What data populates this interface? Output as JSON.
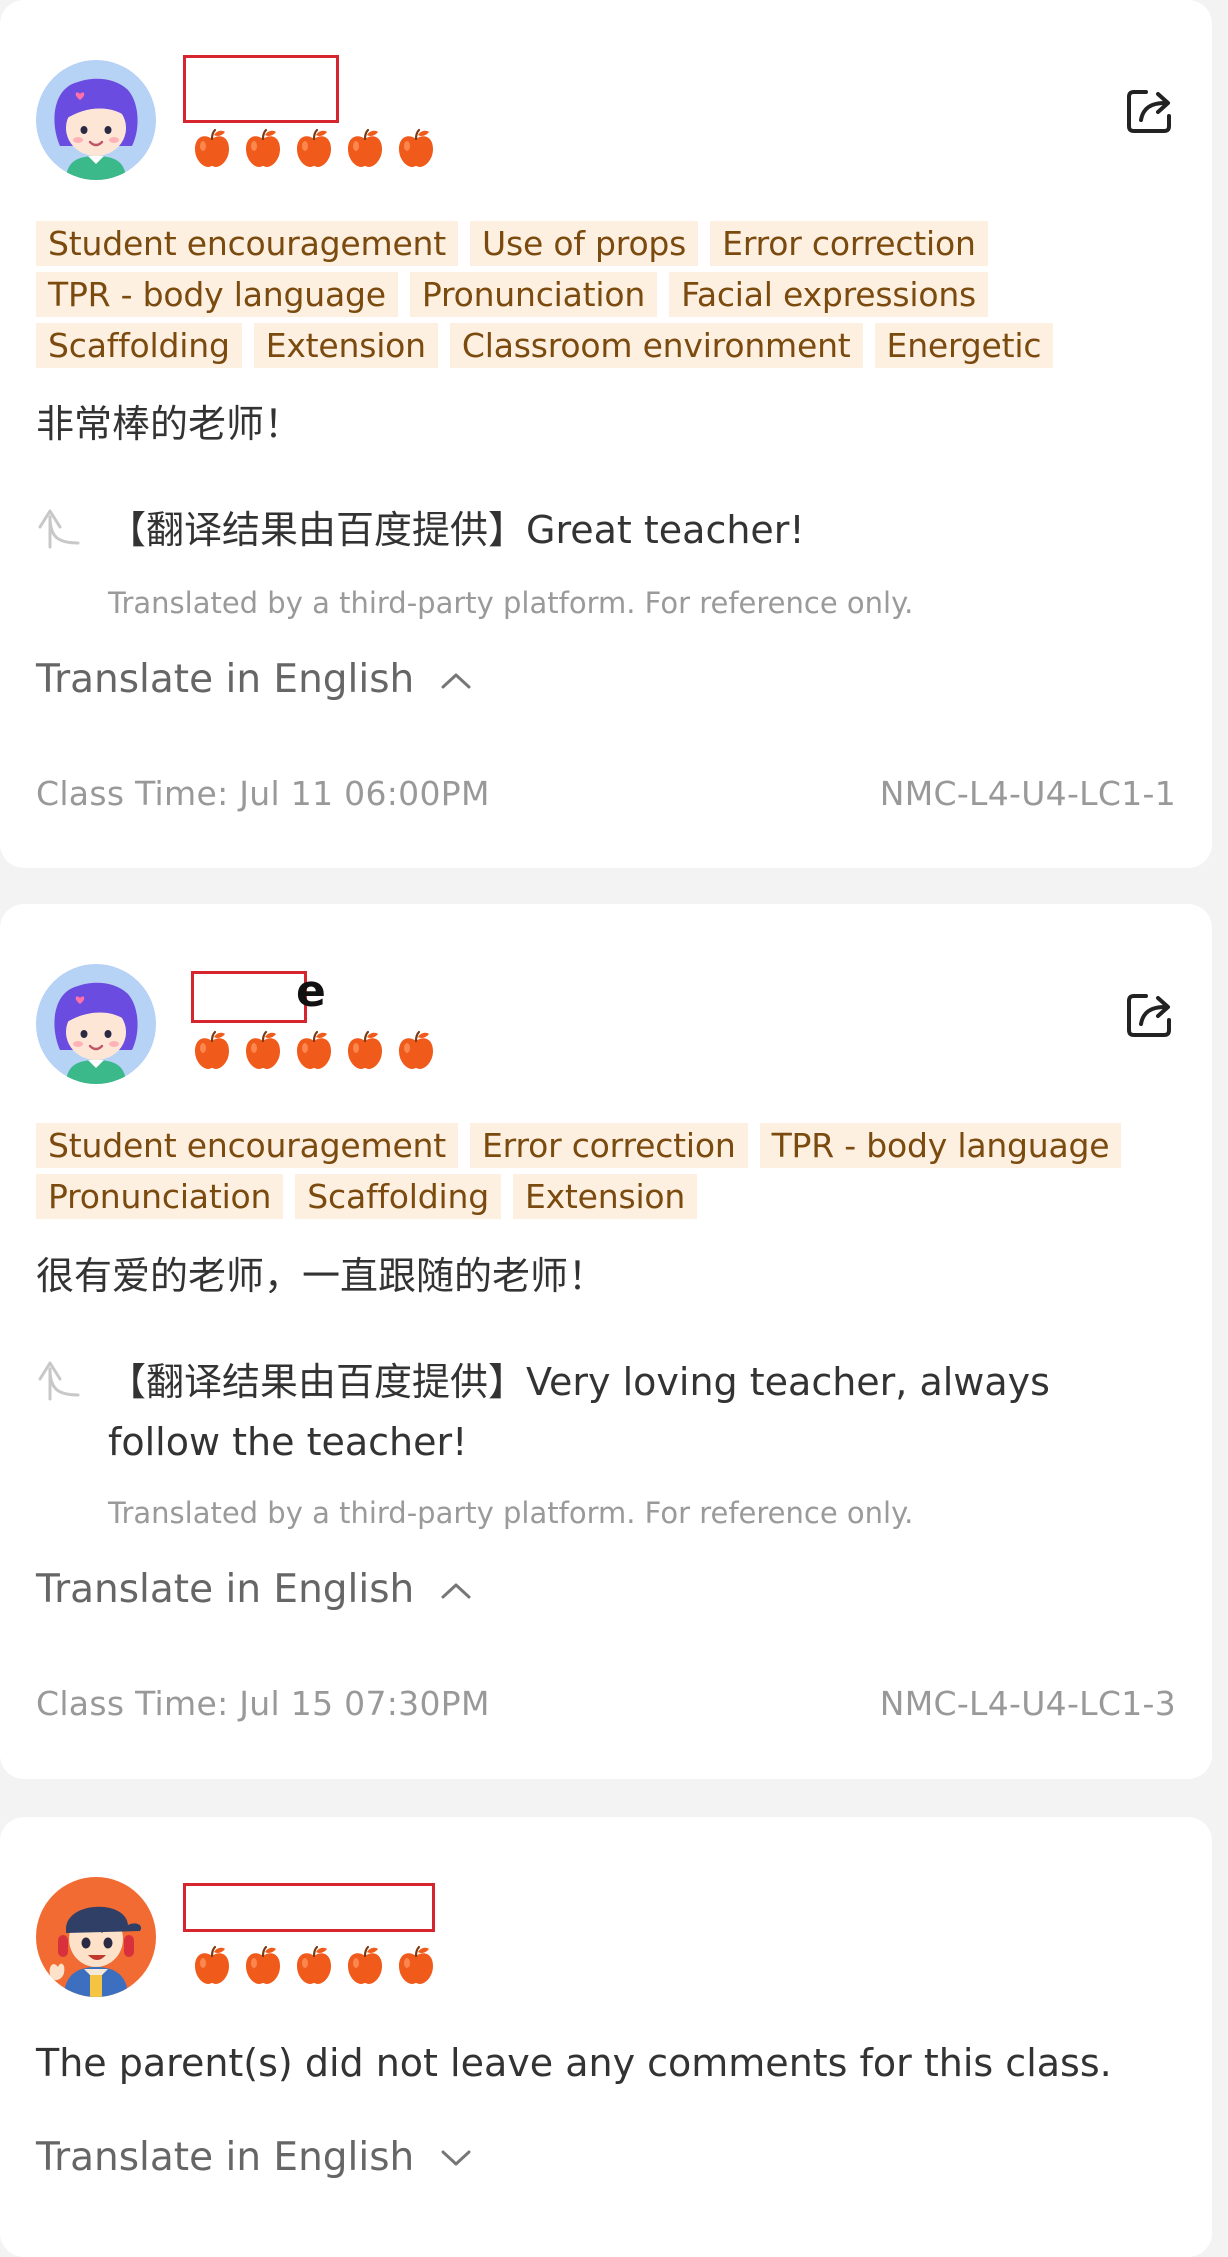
{
  "colors": {
    "accent_red": "#d6252f",
    "apple": "#f05a1a",
    "tag_bg": "#fdf0e1",
    "tag_text": "#7a4a0e"
  },
  "cards": [
    {
      "avatar": "girl-avatar-icon",
      "name_suffix": "",
      "rating": 5,
      "tags": [
        "Student encouragement",
        "Use of props",
        "Error correction",
        "TPR - body language",
        "Pronunciation",
        "Facial expressions",
        "Scaffolding",
        "Extension",
        "Classroom environment",
        "Energetic"
      ],
      "comment": "非常棒的老师！",
      "translation": "【翻译结果由百度提供】Great teacher!",
      "note": "Translated by a third-party platform. For reference only.",
      "translate_label": "Translate in English",
      "class_time": "Class Time: Jul 11 06:00PM",
      "class_code": "NMC-L4-U4-LC1-1"
    },
    {
      "avatar": "girl-avatar-icon",
      "name_suffix": "e",
      "rating": 5,
      "tags": [
        "Student encouragement",
        "Error correction",
        "TPR - body language",
        "Pronunciation",
        "Scaffolding",
        "Extension"
      ],
      "comment": "很有爱的老师，一直跟随的老师！",
      "translation": "【翻译结果由百度提供】Very loving teacher, always follow the teacher!",
      "note": "Translated by a third-party platform. For reference only.",
      "translate_label": "Translate in English",
      "class_time": "Class Time: Jul 15 07:30PM",
      "class_code": "NMC-L4-U4-LC1-3"
    },
    {
      "avatar": "boy-avatar-icon",
      "name_suffix": "",
      "rating": 5,
      "comment": "The parent(s) did not leave any comments for this class.",
      "translate_label": "Translate in English"
    }
  ]
}
